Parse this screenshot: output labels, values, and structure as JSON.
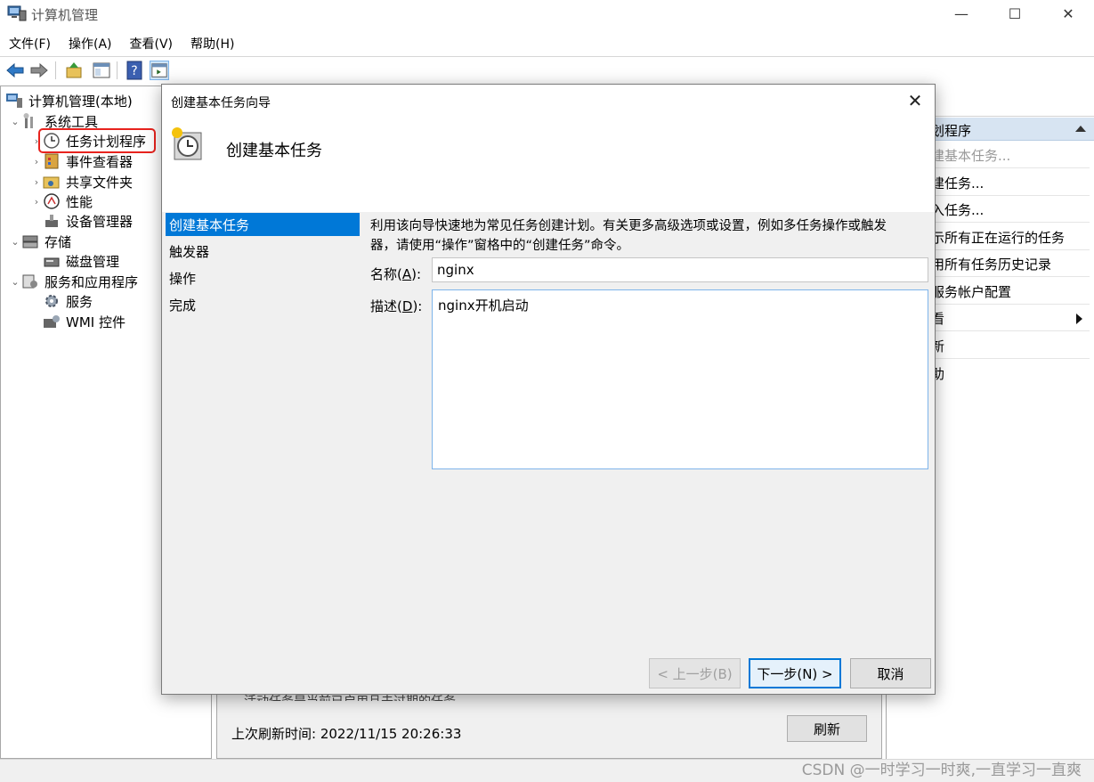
{
  "window": {
    "title": "计算机管理",
    "controls": {
      "minimize": "—",
      "maximize": "☐",
      "close": "✕"
    }
  },
  "menubar": [
    {
      "label": "文件(F)"
    },
    {
      "label": "操作(A)"
    },
    {
      "label": "查看(V)"
    },
    {
      "label": "帮助(H)"
    }
  ],
  "tree": {
    "root": "计算机管理(本地)",
    "system_tools": "系统工具",
    "task_scheduler": "任务计划程序",
    "event_viewer": "事件查看器",
    "shared_folders": "共享文件夹",
    "performance": "性能",
    "device_manager": "设备管理器",
    "storage": "存储",
    "disk_management": "磁盘管理",
    "services_apps": "服务和应用程序",
    "services": "服务",
    "wmi": "WMI 控件"
  },
  "middle": {
    "cut_text": "活动任务是当前已启用且未过期的任务",
    "last_refresh": "上次刷新时间: 2022/11/15 20:26:33",
    "refresh_button": "刷新"
  },
  "actions": {
    "header": "划程序",
    "items": [
      {
        "label": "建基本任务...",
        "dim": true
      },
      {
        "label": "建任务..."
      },
      {
        "label": "入任务..."
      },
      {
        "label": "示所有正在运行的任务"
      },
      {
        "label": "用所有任务历史记录"
      },
      {
        "label": "服务帐户配置"
      },
      {
        "label": "看"
      },
      {
        "label": "新"
      },
      {
        "label": "助"
      }
    ]
  },
  "dialog": {
    "title": "创建基本任务向导",
    "heading": "创建基本任务",
    "steps": [
      "创建基本任务",
      "触发器",
      "操作",
      "完成"
    ],
    "description_line1": "利用该向导快速地为常见任务创建计划。有关更多高级选项或设置，例如多任务操作或触发",
    "description_line2": "器，请使用“操作”窗格中的“创建任务”命令。",
    "name_label": "名称",
    "name_key": "A",
    "name_value": "nginx",
    "desc_label": "描述",
    "desc_key": "D",
    "desc_value": "nginx开机启动",
    "buttons": {
      "back": "< 上一步(B)",
      "next": "下一步(N) >",
      "cancel": "取消"
    }
  },
  "watermark": "CSDN @一时学习一时爽,一直学习一直爽",
  "colors": {
    "selection": "#0078d7",
    "highlight_box": "#e8231e",
    "actions_header": "#d7e4f2"
  }
}
